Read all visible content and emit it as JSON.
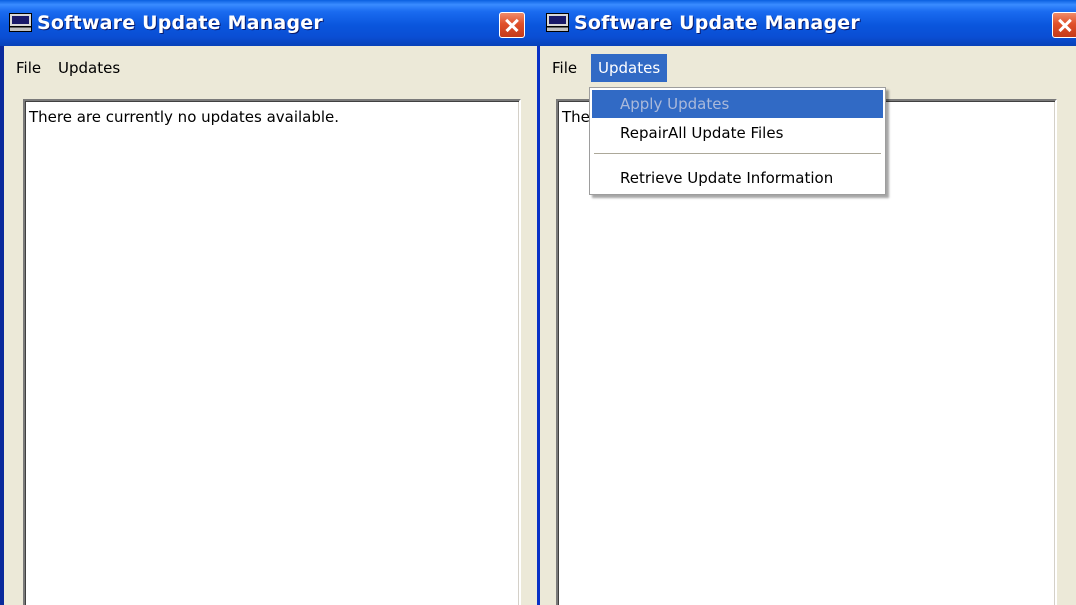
{
  "left_window": {
    "title": "Software Update Manager",
    "menu": {
      "file": "File",
      "updates": "Updates"
    },
    "content_text": "There are currently no updates available."
  },
  "right_window": {
    "title": "Software Update Manager",
    "menu": {
      "file": "File",
      "updates": "Updates"
    },
    "content_text": "The",
    "updates_menu_items": [
      {
        "label": "Apply Updates",
        "state": "highlighted, disabled"
      },
      {
        "label": "RepairAll Update Files",
        "state": "enabled"
      },
      {
        "label": "Retrieve Update Information",
        "state": "enabled"
      }
    ]
  },
  "colors": {
    "titlebar": "#0a56dd",
    "menu_highlight": "#316ac5",
    "window_face": "#ece9d8",
    "close_button": "#e0502a"
  },
  "icons": {
    "app": "monitor-icon",
    "close": "close-x-icon"
  }
}
